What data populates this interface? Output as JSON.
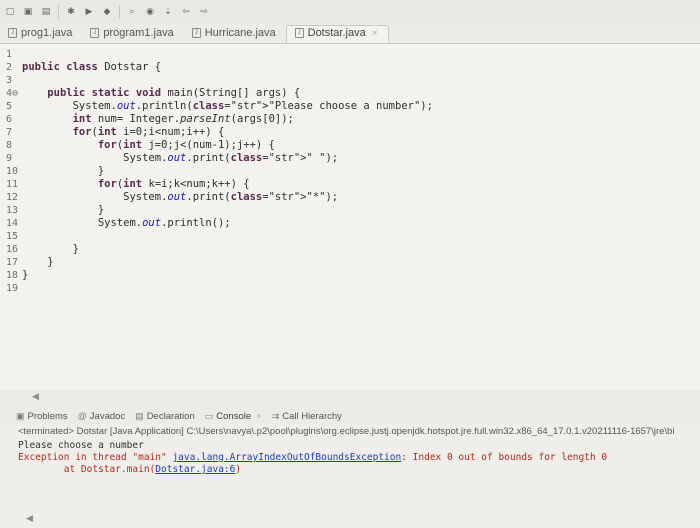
{
  "toolbar": {
    "icons": [
      "new-icon",
      "save-icon",
      "print-icon",
      "debug-icon",
      "run-icon",
      "new-class-icon",
      "search-icon",
      "open-type-icon",
      "next-annotation-icon",
      "back-icon",
      "forward-icon"
    ]
  },
  "tabs": [
    {
      "label": "prog1.java",
      "active": false
    },
    {
      "label": "program1.java",
      "active": false
    },
    {
      "label": "Hurricane.java",
      "active": false
    },
    {
      "label": "Dotstar.java",
      "active": true,
      "close": "×"
    }
  ],
  "editor": {
    "lines": [
      {
        "n": "1",
        "text": ""
      },
      {
        "n": "2",
        "text": "public class Dotstar {"
      },
      {
        "n": "3",
        "text": ""
      },
      {
        "n": "4⊖",
        "text": "    public static void main(String[] args) {"
      },
      {
        "n": "5",
        "text": "        System.out.println(\"Please choose a number\");"
      },
      {
        "n": "6",
        "text": "        int num= Integer.parseInt(args[0]);"
      },
      {
        "n": "7",
        "text": "        for(int i=0;i<num;i++) {"
      },
      {
        "n": "8",
        "text": "            for(int j=0;j<(num-1);j++) {"
      },
      {
        "n": "9",
        "text": "                System.out.print(\" \");"
      },
      {
        "n": "10",
        "text": "            }"
      },
      {
        "n": "11",
        "text": "            for(int k=i;k<num;k++) {"
      },
      {
        "n": "12",
        "text": "                System.out.print(\"*\");"
      },
      {
        "n": "13",
        "text": "            }"
      },
      {
        "n": "14",
        "text": "            System.out.println();"
      },
      {
        "n": "15",
        "text": ""
      },
      {
        "n": "16",
        "text": "        }"
      },
      {
        "n": "17",
        "text": "    }"
      },
      {
        "n": "18",
        "text": "}"
      },
      {
        "n": "19",
        "text": ""
      }
    ]
  },
  "console": {
    "tabs": [
      {
        "label": "Problems",
        "icon": "problems-icon"
      },
      {
        "label": "Javadoc",
        "icon": "javadoc-icon"
      },
      {
        "label": "Declaration",
        "icon": "declaration-icon"
      },
      {
        "label": "Console",
        "icon": "console-icon",
        "active": true,
        "close": "×"
      },
      {
        "label": "Call Hierarchy",
        "icon": "call-hierarchy-icon"
      }
    ],
    "terminated": "<terminated> Dotstar [Java Application] C:\\Users\\navya\\.p2\\pool\\plugins\\org.eclipse.justj.openjdk.hotspot.jre.full.win32.x86_64_17.0.1.v20211116-1657\\jre\\bi",
    "output": "Please choose a number",
    "exception_prefix": "Exception in thread \"main\" ",
    "exception_class": "java.lang.ArrayIndexOutOfBoundsException",
    "exception_msg": ": Index 0 out of bounds for length 0",
    "trace_prefix": "        at Dotstar.main(",
    "trace_link": "Dotstar.java:6",
    "trace_suffix": ")"
  }
}
